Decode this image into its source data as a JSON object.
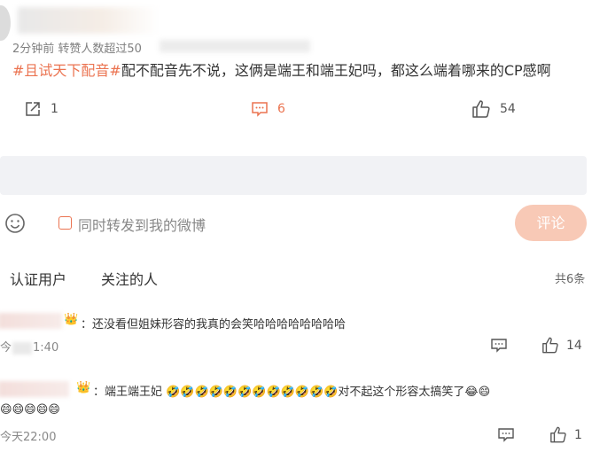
{
  "post": {
    "meta": "2分钟前  转赞人数超过50",
    "hashtag": "#且试天下配音#",
    "text": "配不配音先不说，这俩是端王和端王妃吗，都这么端着哪来的CP感啊",
    "reposts": "1",
    "comments": "6",
    "likes": "54"
  },
  "composer": {
    "forward_label": "同时转发到我的微博",
    "submit_label": "评论"
  },
  "filters": {
    "verified": "认证用户",
    "following": "关注的人",
    "total": "共6条"
  },
  "comments": [
    {
      "badge": "👑",
      "text": "：还没看但姐妹形容的我真的会笑哈哈哈哈哈哈哈哈",
      "time_prefix": "今",
      "time_suffix": "1:40",
      "likes": "14"
    },
    {
      "badge": "👑",
      "text_a": "：端王端王妃",
      "text_b": "对不起这个形容太搞笑了",
      "rofl": "🤣",
      "grin": "😂",
      "grin2": "😄",
      "time": "今天22:00",
      "likes": "1"
    }
  ],
  "colors": {
    "accent": "#eb7350",
    "band": "#f1f2f5",
    "submit_bg": "#f8c9b6"
  }
}
